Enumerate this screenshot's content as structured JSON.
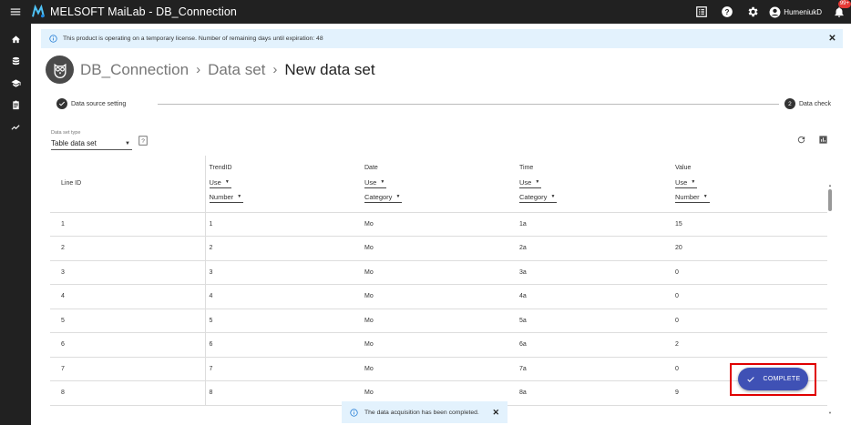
{
  "app": {
    "title": "MELSOFT MaiLab - DB_Connection",
    "user": "HumeniukD",
    "notification_count": "99+"
  },
  "license_banner": {
    "text": "This product is operating on a temporary license. Number of remaining days until expiration: 48"
  },
  "breadcrumb": [
    "DB_Connection",
    "Data set",
    "New data set"
  ],
  "stepper": {
    "step1": "Data source setting",
    "step2_num": "2",
    "step2": "Data check"
  },
  "dataset_type": {
    "label": "Data set type",
    "value": "Table data set"
  },
  "table": {
    "line_id_header": "Line ID",
    "columns": [
      {
        "name": "TrendID",
        "use": "Use",
        "type": "Number"
      },
      {
        "name": "Date",
        "use": "Use",
        "type": "Category"
      },
      {
        "name": "Time",
        "use": "Use",
        "type": "Category"
      },
      {
        "name": "Value",
        "use": "Use",
        "type": "Number"
      }
    ],
    "rows": [
      [
        "1",
        "1",
        "Mo",
        "1a",
        "15"
      ],
      [
        "2",
        "2",
        "Mo",
        "2a",
        "20"
      ],
      [
        "3",
        "3",
        "Mo",
        "3a",
        "0"
      ],
      [
        "4",
        "4",
        "Mo",
        "4a",
        "0"
      ],
      [
        "5",
        "5",
        "Mo",
        "5a",
        "0"
      ],
      [
        "6",
        "6",
        "Mo",
        "6a",
        "2"
      ],
      [
        "7",
        "7",
        "Mo",
        "7a",
        "0"
      ],
      [
        "8",
        "8",
        "Mo",
        "8a",
        "9"
      ]
    ]
  },
  "complete_button": {
    "label": "COMPLETE"
  },
  "toast": {
    "text": "The data acquisition has been completed."
  },
  "colors": {
    "topbar": "#212121",
    "accent": "#3f51b5",
    "banner": "#e3f2fd",
    "highlight": "#e00000"
  }
}
